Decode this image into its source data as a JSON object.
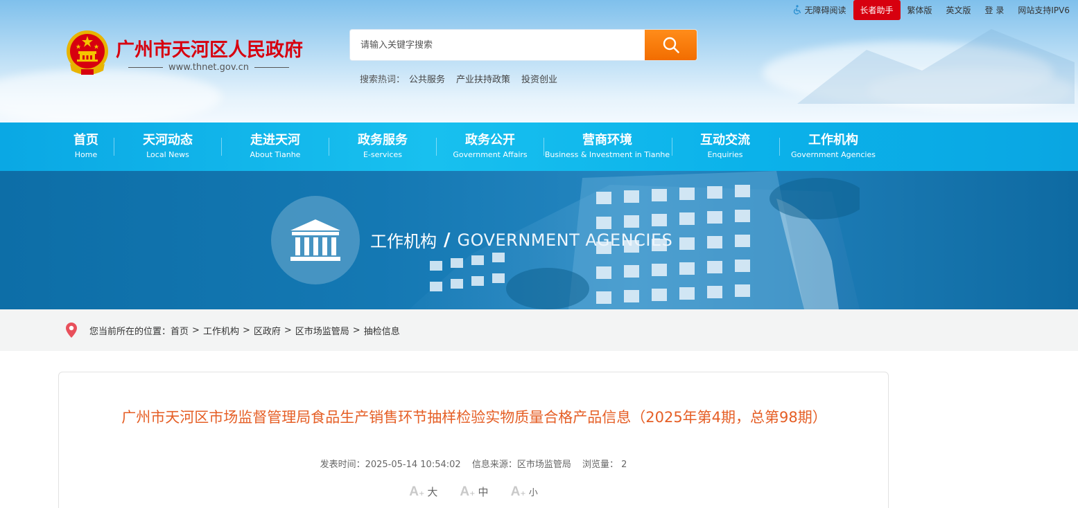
{
  "topbar": {
    "accessibility": "无障碍阅读",
    "elder_assistant": "长者助手",
    "traditional": "繁体版",
    "english": "英文版",
    "login": "登 录",
    "ipv6": "网站支持IPV6"
  },
  "site": {
    "name": "广州市天河区人民政府",
    "url": "www.thnet.gov.cn"
  },
  "search": {
    "placeholder": "请输入关键字搜索",
    "hot_label": "搜索热词：",
    "hot_words": [
      "公共服务",
      "产业扶持政策",
      "投资创业"
    ]
  },
  "nav": [
    {
      "zh": "首页",
      "en": "Home"
    },
    {
      "zh": "天河动态",
      "en": "Local News"
    },
    {
      "zh": "走进天河",
      "en": "About Tianhe"
    },
    {
      "zh": "政务服务",
      "en": "E-services"
    },
    {
      "zh": "政务公开",
      "en": "Government Affairs"
    },
    {
      "zh": "营商环境",
      "en": "Business & Investment in Tianhe"
    },
    {
      "zh": "互动交流",
      "en": "Enquiries"
    },
    {
      "zh": "工作机构",
      "en": "Government Agencies"
    }
  ],
  "banner": {
    "title_zh": "工作机构",
    "slash": "/",
    "title_en": "GOVERNMENT AGENCIES"
  },
  "breadcrumb": {
    "label": "您当前所在的位置：",
    "items": [
      "首页",
      "工作机构",
      "区政府",
      "区市场监管局",
      "抽检信息"
    ],
    "separator": ">"
  },
  "article": {
    "title": "广州市天河区市场监督管理局食品生产销售环节抽样检验实物质量合格产品信息（2025年第4期，总第98期）",
    "publish_time": "发表时间：2025-05-14 10:54:02",
    "source": "信息来源：区市场监管局",
    "views_label": "浏览量：",
    "views": "2",
    "font_sizes": [
      {
        "glyph": "A",
        "sup": "+",
        "label": "大"
      },
      {
        "glyph": "A",
        "sup": "+",
        "label": "中"
      },
      {
        "glyph": "A",
        "sup": "+",
        "label": "小"
      }
    ]
  },
  "colors": {
    "brand_red": "#d7000f",
    "nav_blue": "#18c0ef",
    "search_orange": "#f47a0a",
    "title_orange": "#e55e25"
  }
}
